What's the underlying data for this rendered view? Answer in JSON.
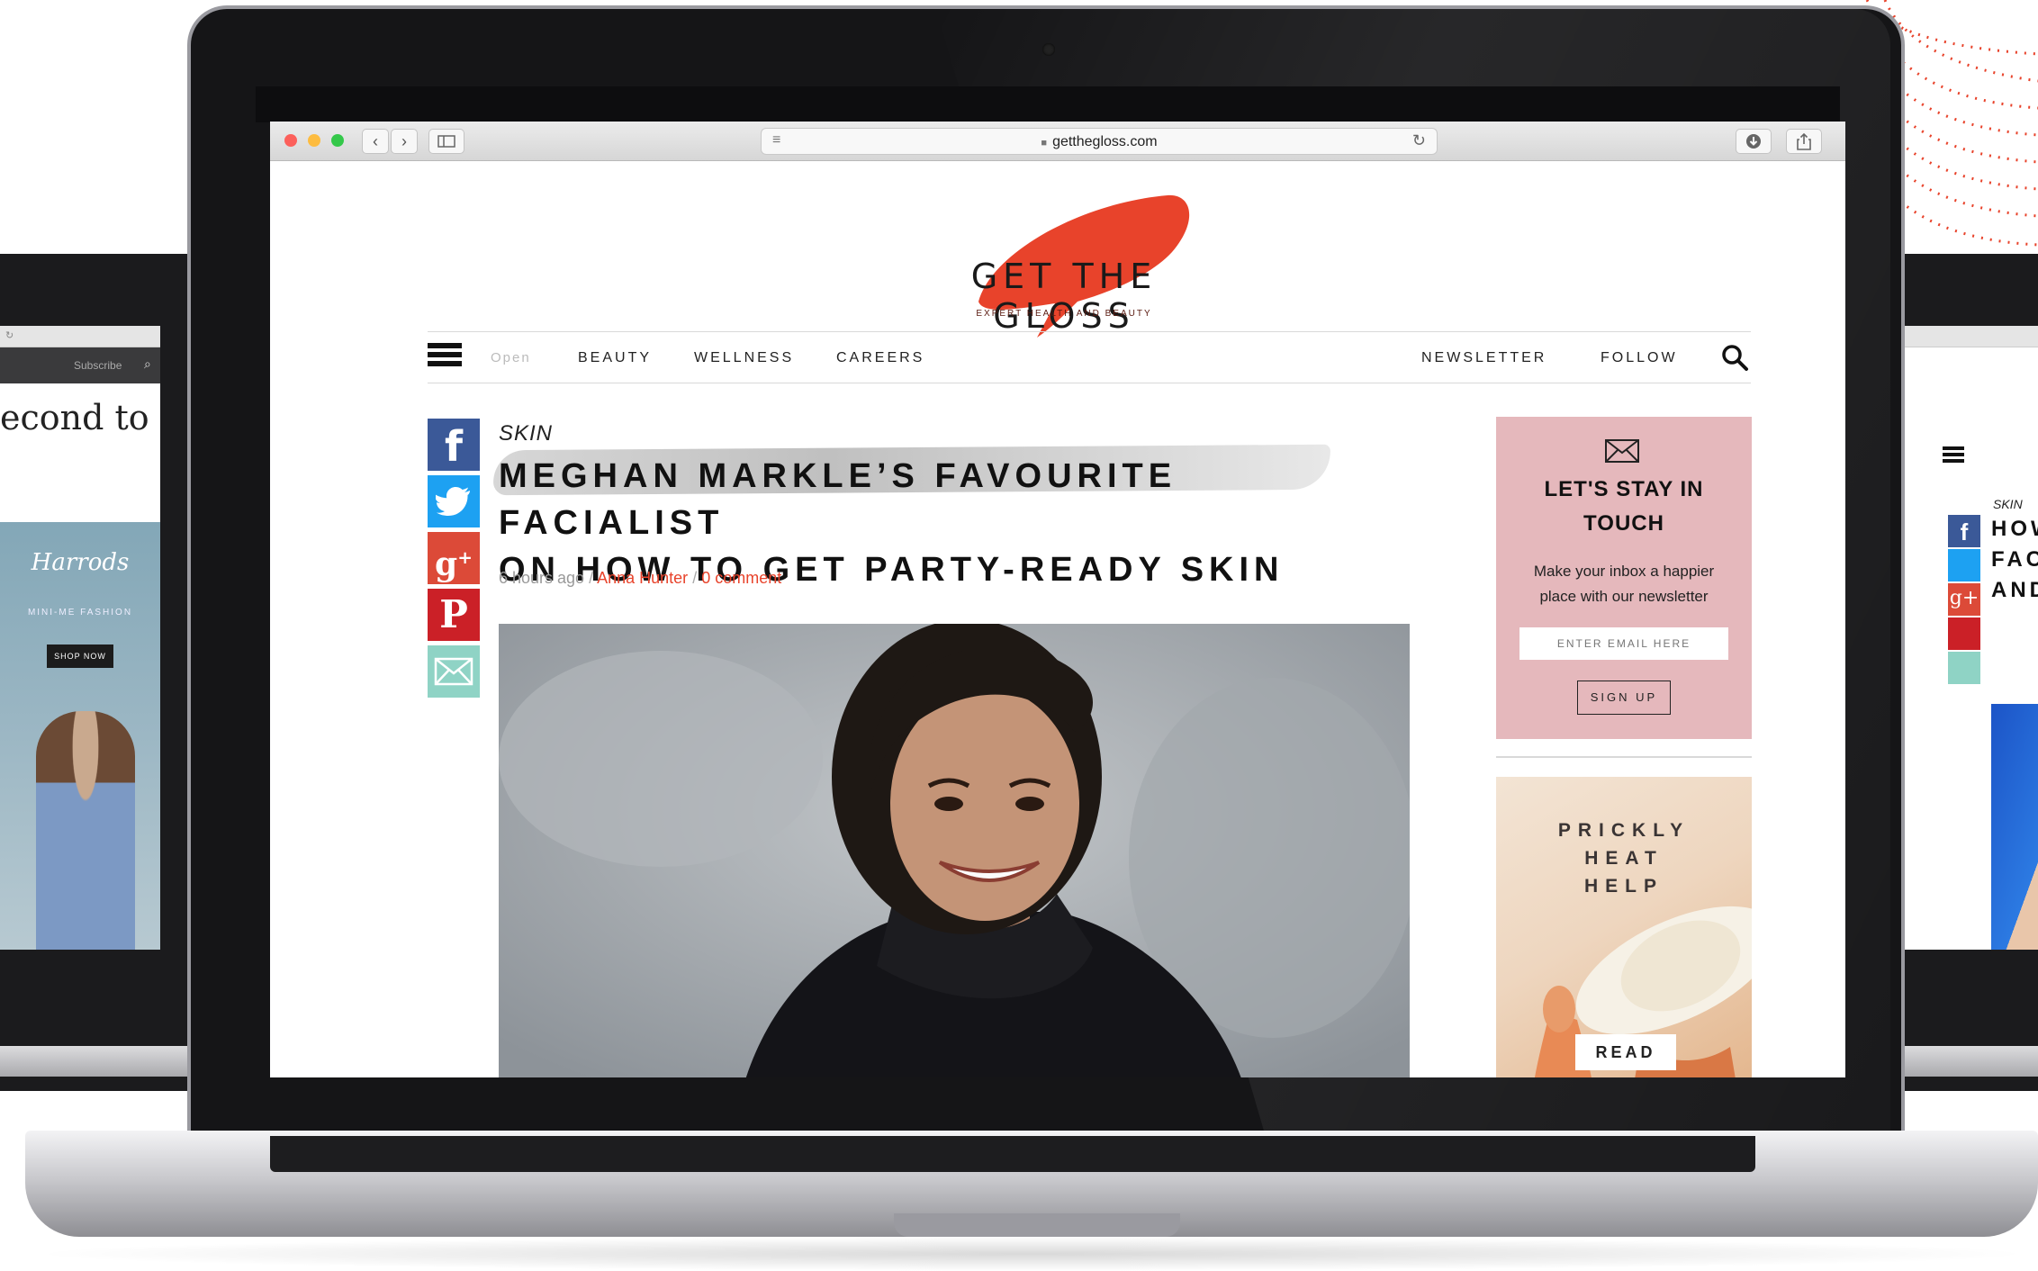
{
  "browser": {
    "url": "getthegloss.com"
  },
  "site": {
    "logo_title": "GET THE GLOSS",
    "logo_tagline": "EXPERT HEALTH AND BEAUTY",
    "brand_color": "#e8432b"
  },
  "nav": {
    "open_label": "Open",
    "items": [
      "BEAUTY",
      "WELLNESS",
      "CAREERS"
    ],
    "newsletter": "NEWSLETTER",
    "follow": "FOLLOW"
  },
  "article": {
    "category": "SKIN",
    "headline_line1": "MEGHAN MARKLE’S FAVOURITE FACIALIST",
    "headline_line2": "ON HOW TO GET PARTY-READY SKIN",
    "time": "6 hours ago",
    "author": "Anna Hunter",
    "comments": "0 comment"
  },
  "social": [
    "facebook-icon",
    "twitter-icon",
    "google-plus-icon",
    "pinterest-icon",
    "mail-icon"
  ],
  "newsletter": {
    "title_line1": "LET'S STAY IN",
    "title_line2": "TOUCH",
    "text_line1": "Make your inbox a happier",
    "text_line2": "place with our newsletter",
    "input_placeholder": "ENTER EMAIL HERE",
    "button": "SIGN UP",
    "bg_color": "#e5b8bc"
  },
  "ad": {
    "line1": "PRICKLY",
    "line2": "HEAT",
    "line3": "HELP",
    "button": "READ"
  },
  "side_left": {
    "toolbar_text": "Subscribe",
    "headline_fragment": "econd to non",
    "brand": "Harrods",
    "promo": "MINI-ME FASHION",
    "button": "SHOP NOW"
  },
  "side_right": {
    "category": "SKIN",
    "line1": "HOW",
    "line2": "FACI",
    "line3": "AND"
  }
}
